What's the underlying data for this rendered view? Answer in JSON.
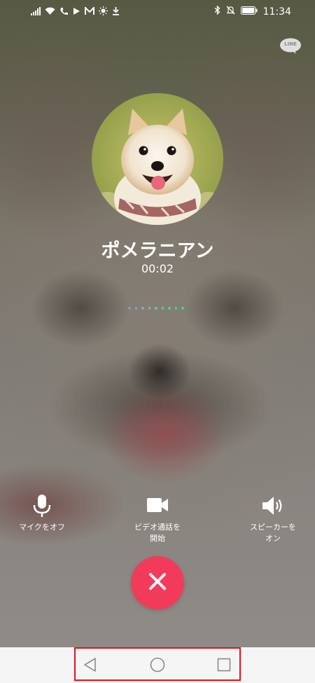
{
  "status_bar": {
    "time": "11:34",
    "left_icons": [
      "signal-icon",
      "wifi-icon",
      "phone-call-icon",
      "play-icon",
      "mail-icon",
      "brightness-icon",
      "download-icon"
    ],
    "right_icons": [
      "bluetooth-icon",
      "mute-icon",
      "battery-icon"
    ]
  },
  "app_logo": {
    "name": "line-logo-icon",
    "text": "LINE"
  },
  "call": {
    "contact_name": "ポメラニアン",
    "duration": "00:02"
  },
  "controls": {
    "mic": {
      "label": "マイクをオフ",
      "icon": "microphone-icon"
    },
    "video": {
      "label": "ビデオ通話を\n開始",
      "icon": "video-camera-icon"
    },
    "speaker": {
      "label": "スピーカーを\nオン",
      "icon": "speaker-icon"
    },
    "end_call": {
      "icon": "close-icon",
      "color": "#f23b5b"
    }
  },
  "nav_bar": {
    "buttons": [
      "back-icon",
      "home-icon",
      "recents-icon"
    ],
    "highlight_color": "#e0141e"
  },
  "colors": {
    "dots": [
      "#7d9cc0",
      "#7aa6c4",
      "#74b0c2",
      "#6ebabd",
      "#66c2b2",
      "#5ec8a6",
      "#57cc9a",
      "#50cf8e",
      "#48d283"
    ]
  }
}
